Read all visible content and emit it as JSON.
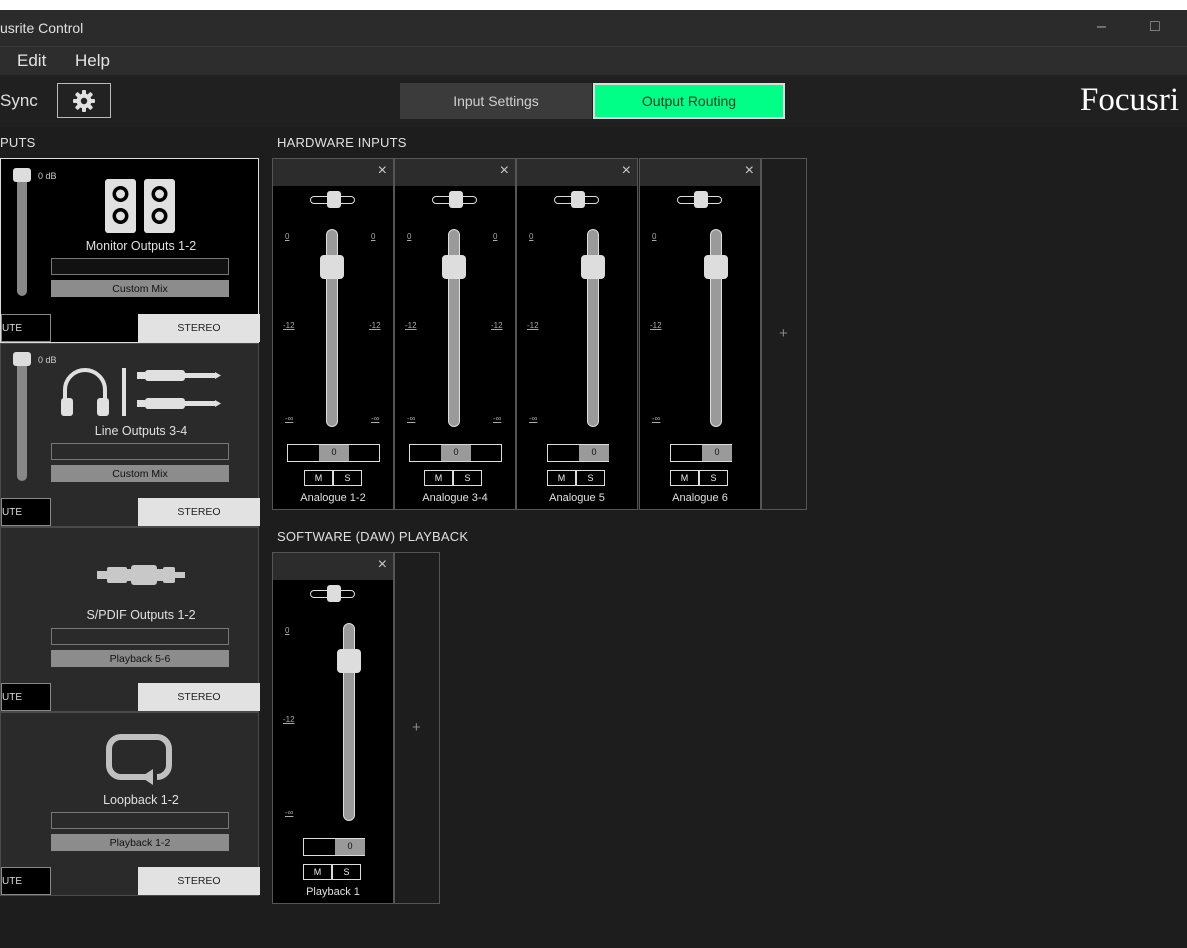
{
  "window": {
    "title": "usrite Control",
    "minimize": "–",
    "maximize": "□"
  },
  "menu": {
    "edit": "Edit",
    "help": "Help"
  },
  "toolbar": {
    "sync": "Sync",
    "tabs": {
      "input": "Input Settings",
      "output": "Output Routing"
    },
    "logo": "Focusri"
  },
  "outputs": {
    "label": "PUTS",
    "blocks": [
      {
        "name": "Monitor Outputs 1-2",
        "db": "0 dB",
        "source": "Custom Mix",
        "mute": "UTE",
        "stereo": "STEREO",
        "icon": "speaker-icon"
      },
      {
        "name": "Line Outputs 3-4",
        "db": "0 dB",
        "source": "Custom Mix",
        "mute": "UTE",
        "stereo": "STEREO",
        "icon": "headphones-jack-icon"
      },
      {
        "name": "S/PDIF Outputs 1-2",
        "source": "Playback 5-6",
        "mute": "UTE",
        "stereo": "STEREO",
        "icon": "spdif-cable-icon"
      },
      {
        "name": "Loopback 1-2",
        "source": "Playback 1-2",
        "mute": "UTE",
        "stereo": "STEREO",
        "icon": "loopback-icon"
      }
    ]
  },
  "hardware": {
    "label": "HARDWARE INPUTS",
    "scale": {
      "top": "0",
      "mid": "-12",
      "bottom": "-∞"
    },
    "strips": [
      {
        "name": "Analogue 1-2",
        "level": "0",
        "m": "M",
        "s": "S",
        "close": "×"
      },
      {
        "name": "Analogue 3-4",
        "level": "0",
        "m": "M",
        "s": "S",
        "close": "×"
      },
      {
        "name": "Analogue 5",
        "level": "0",
        "m": "M",
        "s": "S",
        "close": "×"
      },
      {
        "name": "Analogue 6",
        "level": "0",
        "m": "M",
        "s": "S",
        "close": "×"
      }
    ],
    "add": "+"
  },
  "software": {
    "label": "SOFTWARE (DAW) PLAYBACK",
    "scale": {
      "top": "0",
      "mid": "-12",
      "bottom": "-∞"
    },
    "strips": [
      {
        "name": "Playback 1",
        "level": "0",
        "m": "M",
        "s": "S",
        "close": "×"
      }
    ],
    "add": "+"
  }
}
